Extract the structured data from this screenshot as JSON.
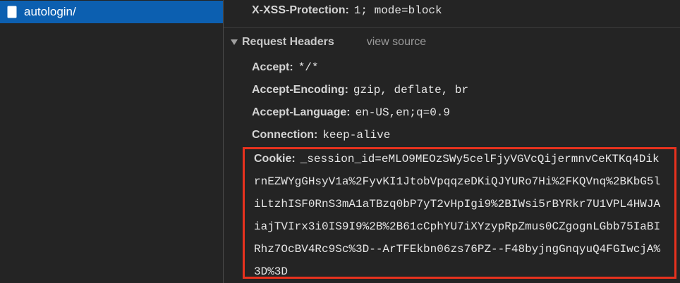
{
  "request_list": {
    "items": [
      {
        "name": "autologin/",
        "icon": "document-icon",
        "selected": true
      }
    ]
  },
  "headers": {
    "response_partial": {
      "name": "X-XSS-Protection",
      "value": "1; mode=block"
    },
    "request_section": {
      "title": "Request Headers",
      "view_source_label": "view source",
      "expanded": true,
      "items": [
        {
          "name": "Accept",
          "value": "*/*"
        },
        {
          "name": "Accept-Encoding",
          "value": "gzip, deflate, br"
        },
        {
          "name": "Accept-Language",
          "value": "en-US,en;q=0.9"
        },
        {
          "name": "Connection",
          "value": "keep-alive"
        }
      ]
    },
    "cookie": {
      "name": "Cookie",
      "lines": [
        "_session_id=eMLO9MEOzSWy5celFjyVGVcQijermnvCeKTKq4Dik",
        "rnEZWYgGHsyV1a%2FyvKI1JtobVpqqzeDKiQJYURo7Hi%2FKQVnq%2BKbG5l",
        "iLtzhISF0RnS3mA1aTBzq0bP7yT2vHpIgi9%2BIWsi5rBYRkr7U1VPL4HWJA",
        "iajTVIrx3i0IS9I9%2B%2B61cCphYU7iXYzypRpZmus0CZgognLGbb75IaBI",
        "Rhz7OcBV4Rc9Sc%3D--ArTFEkbn06zs76PZ--F48byjngGnqyuQ4FGIwcjA%",
        "3D%3D"
      ]
    }
  },
  "colors": {
    "selected_row": "#0c5fb0",
    "highlight_border": "#e8321e",
    "background": "#242424"
  }
}
